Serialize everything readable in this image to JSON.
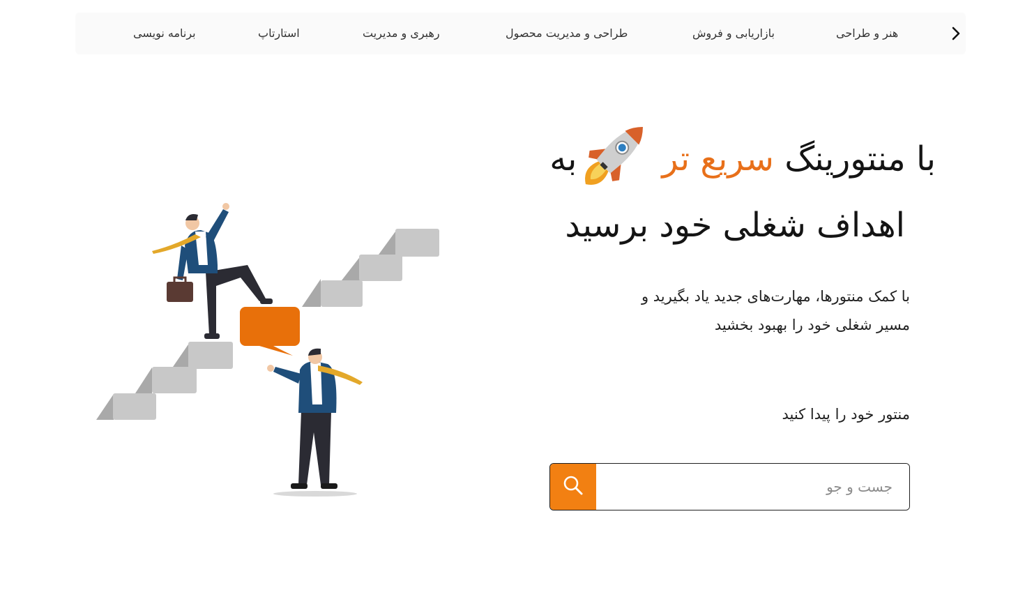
{
  "categories": {
    "next_icon": "chevron-right-icon",
    "items": [
      {
        "label": "هنر و طراحی"
      },
      {
        "label": "بازاریابی و فروش"
      },
      {
        "label": "طراحی و مدیریت محصول"
      },
      {
        "label": "رهبری و مدیریت"
      },
      {
        "label": "استارتاپ"
      },
      {
        "label": "برنامه نویسی"
      }
    ]
  },
  "hero": {
    "title_part1": "با منتورینگ",
    "title_accent": "سریع تر",
    "title_part2": "به",
    "title_line2": "اهداف شغلی خود برسید",
    "subtitle_line1": "با کمک منتورها، مهارت‌های جدید یاد بگیرید و",
    "subtitle_line2": "مسیر شغلی خود را بهبود بخشید",
    "find_label": "منتور خود را پیدا کنید"
  },
  "search": {
    "placeholder": "جست و جو",
    "value": "",
    "button_icon": "search-icon"
  },
  "colors": {
    "accent": "#e8701a",
    "search_button": "#f28012",
    "bar_bg": "#fafafa"
  }
}
